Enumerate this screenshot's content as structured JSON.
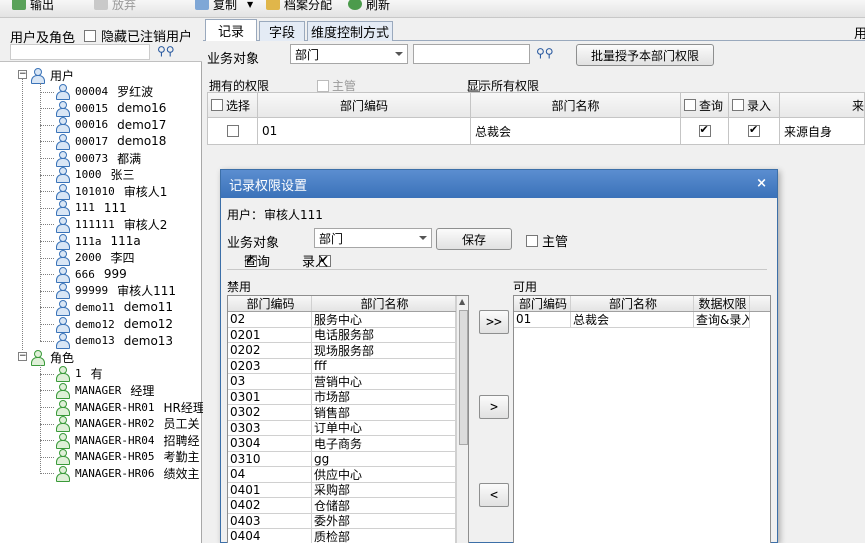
{
  "toolbar": {
    "items": [
      {
        "label": "输出",
        "icon": "export-icon"
      },
      {
        "label": "放弃",
        "icon": "discard-icon"
      },
      {
        "label": "复制",
        "icon": "copy-icon"
      },
      {
        "label": "档案分配",
        "icon": "assign-icon"
      },
      {
        "label": "刷新",
        "icon": "refresh-icon"
      }
    ]
  },
  "left_panel": {
    "title": "用户及角色",
    "hide_cancelled_label": "隐藏已注销用户",
    "tree": {
      "users_label": "用户",
      "users": [
        {
          "code": "00004",
          "name": "罗红波"
        },
        {
          "code": "00015",
          "name": "demo16"
        },
        {
          "code": "00016",
          "name": "demo17"
        },
        {
          "code": "00017",
          "name": "demo18"
        },
        {
          "code": "00073",
          "name": "都满"
        },
        {
          "code": "1000",
          "name": "张三"
        },
        {
          "code": "101010",
          "name": "审核人1"
        },
        {
          "code": "111",
          "name": "111"
        },
        {
          "code": "111111",
          "name": "审核人2"
        },
        {
          "code": "111a",
          "name": "111a"
        },
        {
          "code": "2000",
          "name": "李四"
        },
        {
          "code": "666",
          "name": "999"
        },
        {
          "code": "99999",
          "name": "审核人111"
        },
        {
          "code": "demo11",
          "name": "demo11"
        },
        {
          "code": "demo12",
          "name": "demo12"
        },
        {
          "code": "demo13",
          "name": "demo13"
        }
      ],
      "roles_label": "角色",
      "roles": [
        {
          "code": "1",
          "name": "有"
        },
        {
          "code": "MANAGER",
          "name": "经理"
        },
        {
          "code": "MANAGER-HR01",
          "name": "HR经理"
        },
        {
          "code": "MANAGER-HR02",
          "name": "员工关"
        },
        {
          "code": "MANAGER-HR04",
          "name": "招聘经"
        },
        {
          "code": "MANAGER-HR05",
          "name": "考勤主"
        },
        {
          "code": "MANAGER-HR06",
          "name": "绩效主"
        }
      ]
    }
  },
  "right_panel": {
    "tabs": [
      "记录",
      "字段",
      "维度控制方式"
    ],
    "top_right_text": "用",
    "business_object_label": "业务对象",
    "business_object_value": "部门",
    "batch_button": "批量授予本部门权限",
    "owned_permissions_label": "拥有的权限",
    "supervisor_label": "主管",
    "show_all_label": "显示所有权限",
    "grid": {
      "headers": [
        "选择",
        "部门编码",
        "部门名称",
        "查询",
        "录入",
        "来"
      ],
      "rows": [
        {
          "code": "01",
          "name": "总裁会",
          "query": true,
          "entry": true,
          "source": "来源自身"
        }
      ]
    }
  },
  "dialog": {
    "title": "记录权限设置",
    "close": "×",
    "user_label": "用户：",
    "user_value": "审核人111",
    "business_object_label": "业务对象",
    "business_object_value": "部门",
    "save_button": "保存",
    "supervisor_label": "主管",
    "query_label": "查询",
    "entry_label": "录入",
    "forbidden_label": "禁用",
    "available_label": "可用",
    "forbidden_headers": [
      "部门编码",
      "部门名称"
    ],
    "forbidden_rows": [
      {
        "code": "02",
        "name": "服务中心"
      },
      {
        "code": "0201",
        "name": "电话服务部"
      },
      {
        "code": "0202",
        "name": "现场服务部"
      },
      {
        "code": "0203",
        "name": "fff"
      },
      {
        "code": "03",
        "name": "营销中心"
      },
      {
        "code": "0301",
        "name": "市场部"
      },
      {
        "code": "0302",
        "name": "销售部"
      },
      {
        "code": "0303",
        "name": "订单中心"
      },
      {
        "code": "0304",
        "name": "电子商务"
      },
      {
        "code": "0310",
        "name": "gg"
      },
      {
        "code": "04",
        "name": "供应中心"
      },
      {
        "code": "0401",
        "name": "采购部"
      },
      {
        "code": "0402",
        "name": "仓储部"
      },
      {
        "code": "0403",
        "name": "委外部"
      },
      {
        "code": "0404",
        "name": "质检部"
      }
    ],
    "available_headers": [
      "部门编码",
      "部门名称",
      "数据权限"
    ],
    "available_rows": [
      {
        "code": "01",
        "name": "总裁会",
        "perm": "查询&录入"
      }
    ],
    "move_all_right": ">>",
    "move_right": ">",
    "move_left": "<"
  }
}
